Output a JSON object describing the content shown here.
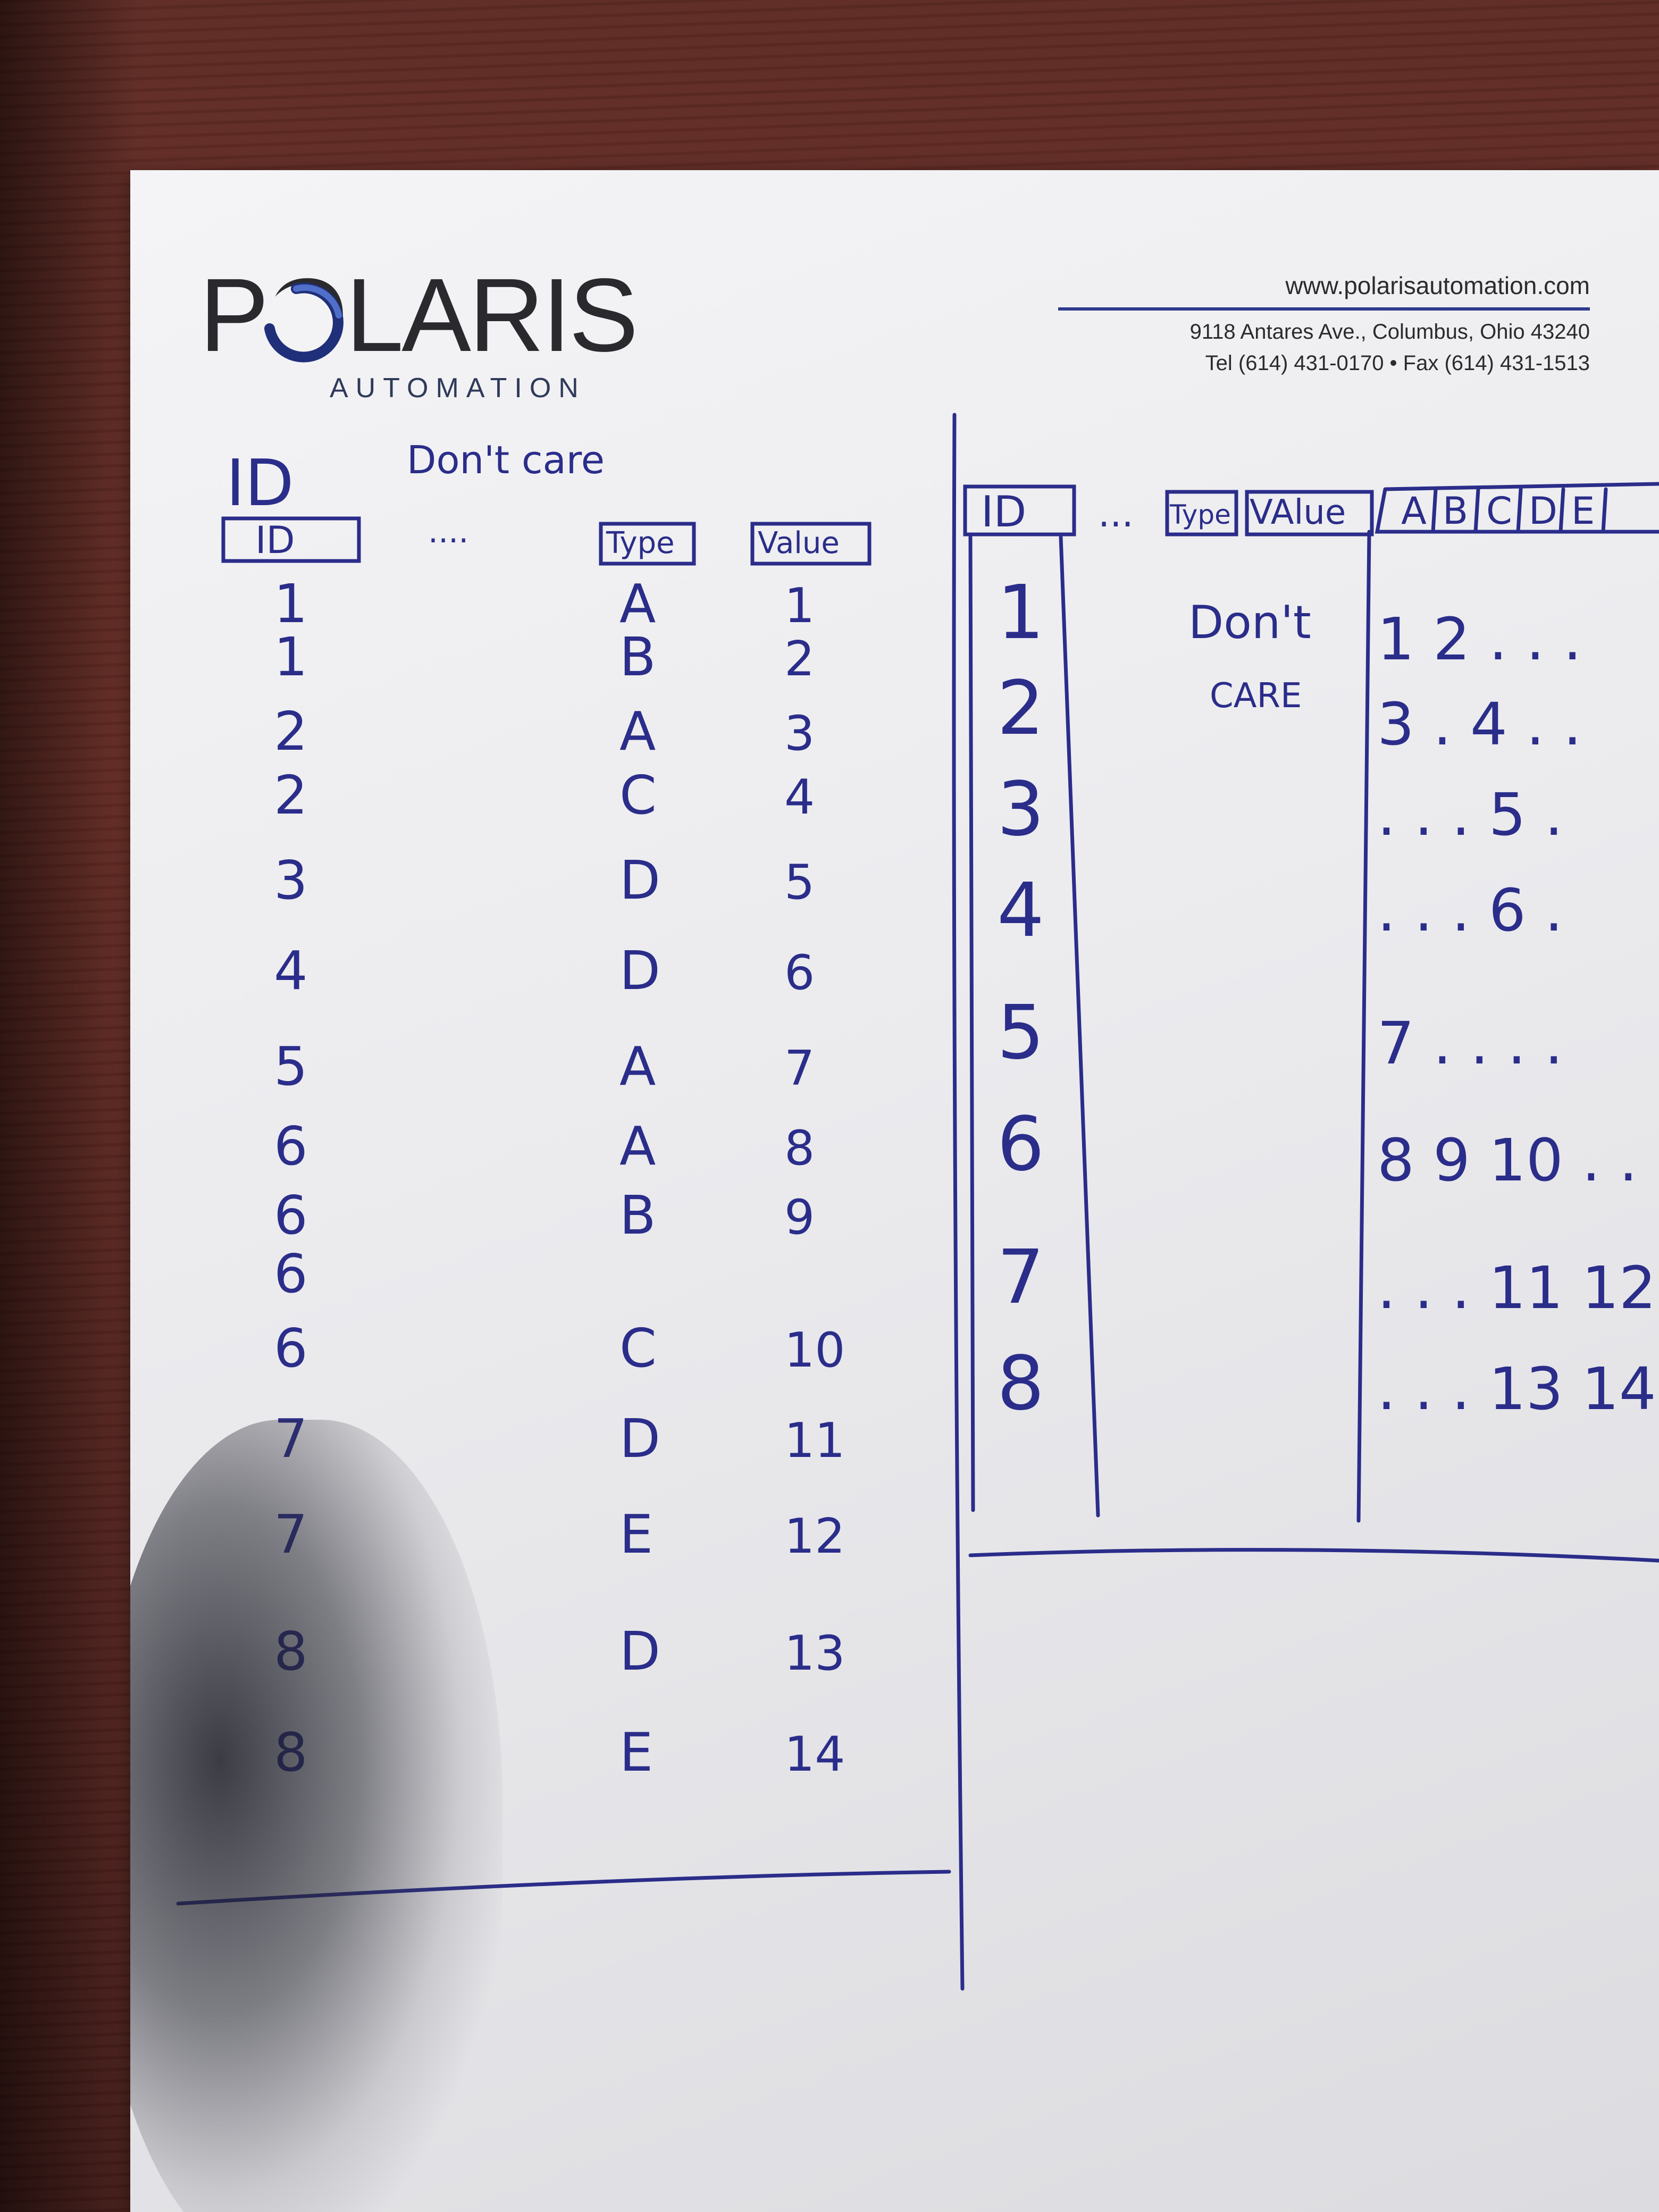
{
  "letterhead": {
    "brand": "POLARIS",
    "brand_sub": "AUTOMATION",
    "website": "www.polarisautomation.com",
    "address": "9118 Antares Ave., Columbus, Ohio 43240",
    "phone_fax": "Tel (614) 431-0170 • Fax (614) 431-1513"
  },
  "ink_color": "#2b2d8a",
  "left_table": {
    "heading_id": "ID",
    "note_dont_care": "Don't care",
    "note_dots": "....",
    "headers": [
      "ID",
      "Type",
      "Value"
    ],
    "rows": [
      {
        "id": "1",
        "type": "A",
        "value": "1"
      },
      {
        "id": "1",
        "type": "B",
        "value": "2"
      },
      {
        "id": "2",
        "type": "A",
        "value": "3"
      },
      {
        "id": "2",
        "type": "C",
        "value": "4"
      },
      {
        "id": "3",
        "type": "D",
        "value": "5"
      },
      {
        "id": "4",
        "type": "D",
        "value": "6"
      },
      {
        "id": "5",
        "type": "A",
        "value": "7"
      },
      {
        "id": "6",
        "type": "A",
        "value": "8"
      },
      {
        "id": "6",
        "type": "B",
        "value": "9"
      },
      {
        "id": "6",
        "type": "",
        "value": ""
      },
      {
        "id": "6",
        "type": "C",
        "value": "10"
      },
      {
        "id": "7",
        "type": "D",
        "value": "11"
      },
      {
        "id": "7",
        "type": "E",
        "value": "12"
      },
      {
        "id": "8",
        "type": "D",
        "value": "13"
      },
      {
        "id": "8",
        "type": "E",
        "value": "14"
      }
    ]
  },
  "right_table": {
    "headers": [
      "ID",
      "...",
      "Type",
      "VAlue",
      "A",
      "B",
      "C",
      "D",
      "E"
    ],
    "note_dont": "Don't",
    "note_care": "CARE",
    "ids": [
      "1",
      "2",
      "3",
      "4",
      "5",
      "6",
      "7",
      "8"
    ],
    "pivot_rows": [
      "1  2 . . .",
      "3 . 4 . .",
      ". . . 5 .",
      ". . . 6 .",
      "7 . . . .",
      "8 9 10 . .",
      ". . . 11 12",
      ". . . 13 14"
    ]
  }
}
